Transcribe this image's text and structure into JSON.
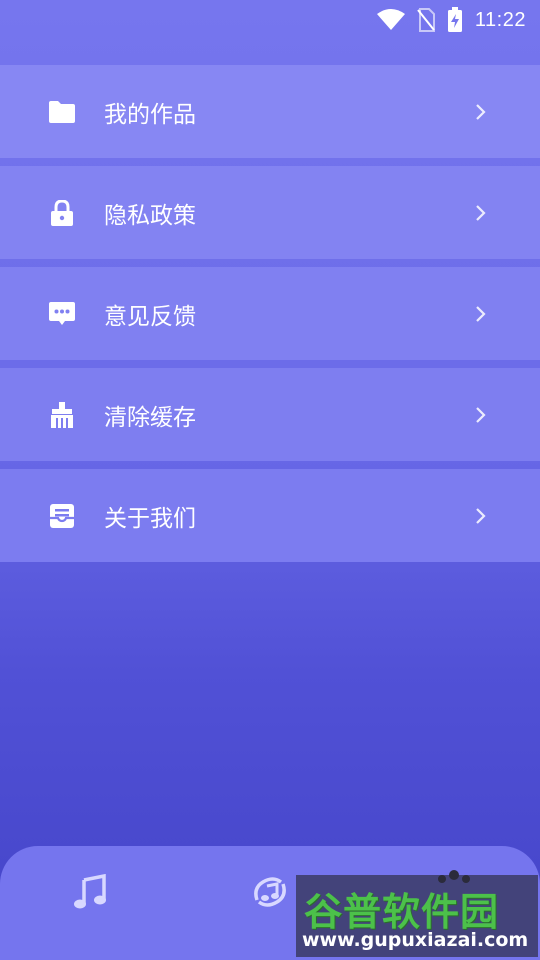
{
  "status_bar": {
    "time": "11:22",
    "icons": [
      "wifi-icon",
      "no-sim-icon",
      "battery-charging-icon"
    ]
  },
  "menu": {
    "items": [
      {
        "label": "我的作品",
        "icon": "folder-icon",
        "bg": "#8787f3"
      },
      {
        "label": "隐私政策",
        "icon": "lock-icon",
        "bg": "#8383f2"
      },
      {
        "label": "意见反馈",
        "icon": "feedback-icon",
        "bg": "#8080f1"
      },
      {
        "label": "清除缓存",
        "icon": "broom-icon",
        "bg": "#7e7ef0"
      },
      {
        "label": "关于我们",
        "icon": "about-icon",
        "bg": "#7c7cf0"
      }
    ]
  },
  "bottom_nav": {
    "items": [
      {
        "icon": "music-note-icon"
      },
      {
        "icon": "music-swirl-icon"
      }
    ]
  },
  "watermark": {
    "title": "谷普软件园",
    "url": "www.gupuxiazai.com"
  }
}
